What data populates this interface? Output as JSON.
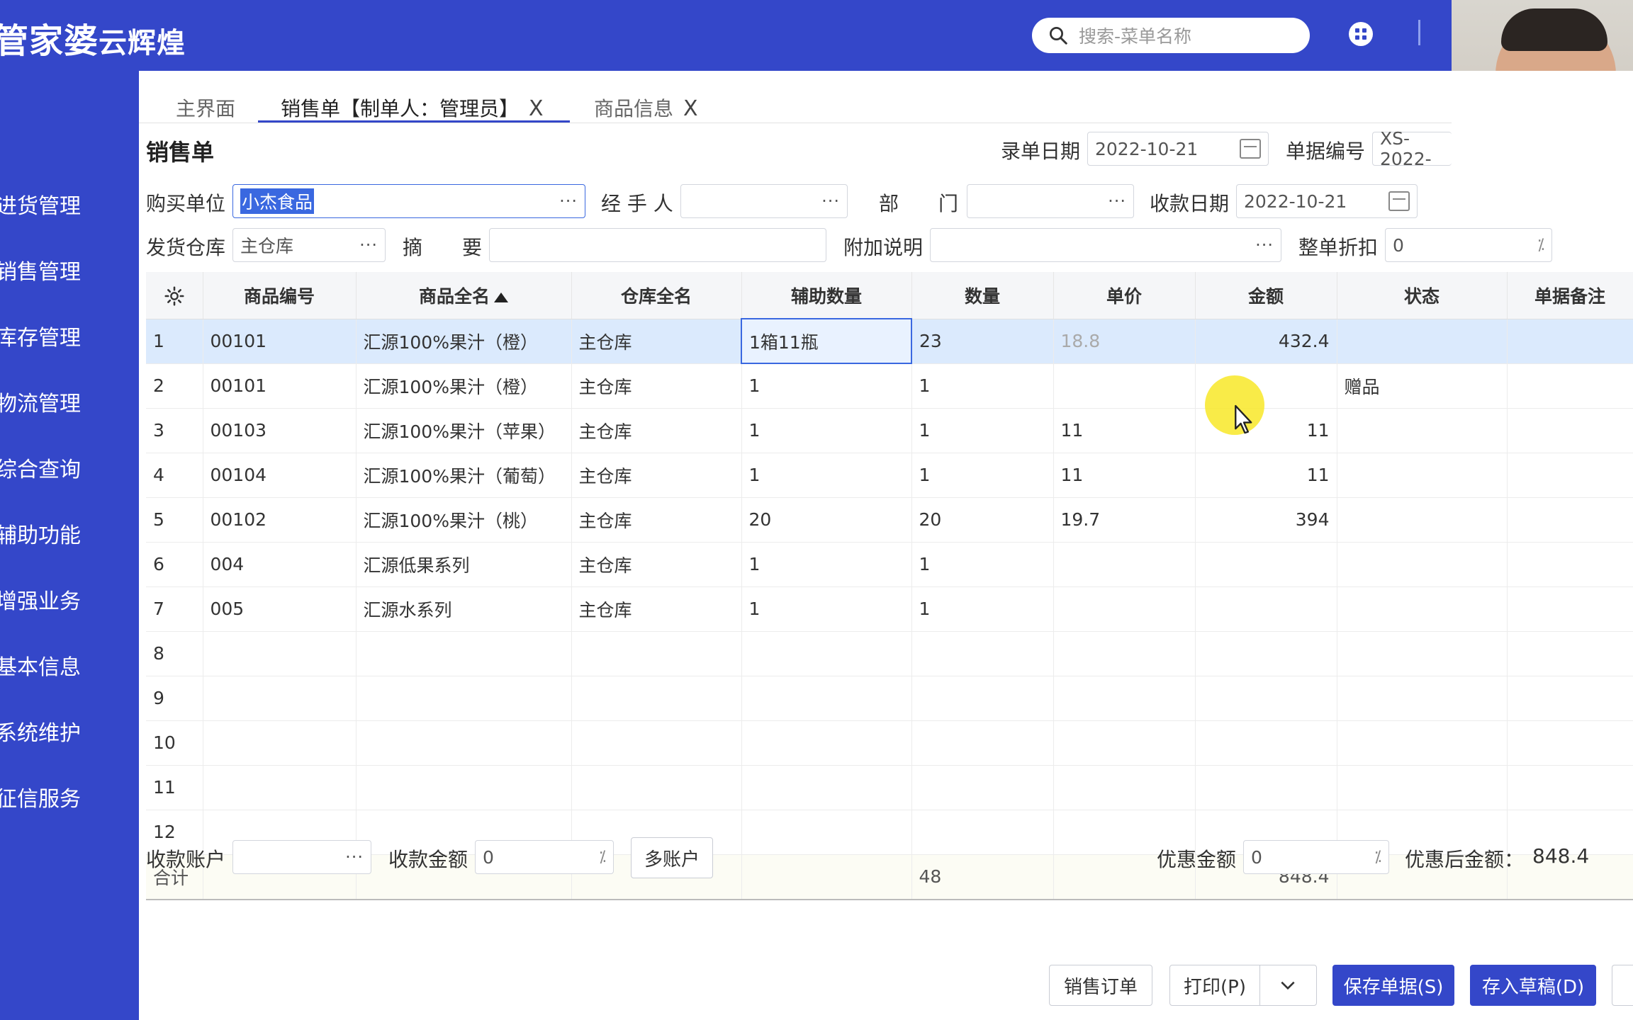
{
  "app": {
    "logo_text": "管家婆",
    "logo_sub": "云辉煌",
    "search_placeholder": "搜索-菜单名称"
  },
  "sidebar": {
    "items": [
      {
        "label": "进货管理"
      },
      {
        "label": "销售管理"
      },
      {
        "label": "库存管理"
      },
      {
        "label": "物流管理"
      },
      {
        "label": "综合查询"
      },
      {
        "label": "辅助功能"
      },
      {
        "label": "增强业务"
      },
      {
        "label": "基本信息"
      },
      {
        "label": "系统维护"
      },
      {
        "label": "征信服务"
      }
    ]
  },
  "tabs": [
    {
      "label": "主界面"
    },
    {
      "label": "销售单【制单人：管理员】",
      "close": "X"
    },
    {
      "label": "商品信息",
      "close": "X"
    }
  ],
  "form": {
    "title": "销售单",
    "entry_date_label": "录单日期",
    "entry_date": "2022-10-21",
    "doc_no_label": "单据编号",
    "doc_no": "XS-2022-",
    "buyer_label": "购买单位",
    "buyer": "小杰食品",
    "handler_label": "经 手 人",
    "handler": "",
    "dept_label_1": "部",
    "dept_label_2": "门",
    "dept": "",
    "pay_date_label": "收款日期",
    "pay_date": "2022-10-21",
    "warehouse_label": "发货仓库",
    "warehouse": "主仓库",
    "summary_label_1": "摘",
    "summary_label_2": "要",
    "summary": "",
    "note_label": "附加说明",
    "note": "",
    "discount_label": "整单折扣",
    "discount": "0",
    "dots": "···"
  },
  "table": {
    "headers": {
      "code": "商品编号",
      "name": "商品全名",
      "wh": "仓库全名",
      "aux_qty": "辅助数量",
      "qty": "数量",
      "price": "单价",
      "amount": "金额",
      "status": "状态",
      "remark": "单据备注"
    },
    "rows": [
      {
        "idx": "1",
        "code": "00101",
        "name": "汇源100%果汁（橙）",
        "wh": "主仓库",
        "aux_qty": "1箱11瓶",
        "qty": "23",
        "price": "18.8",
        "amount": "432.4",
        "status": "",
        "remark": ""
      },
      {
        "idx": "2",
        "code": "00101",
        "name": "汇源100%果汁（橙）",
        "wh": "主仓库",
        "aux_qty": "1",
        "qty": "1",
        "price": "",
        "amount": "",
        "status": "赠品",
        "remark": ""
      },
      {
        "idx": "3",
        "code": "00103",
        "name": "汇源100%果汁（苹果）",
        "wh": "主仓库",
        "aux_qty": "1",
        "qty": "1",
        "price": "11",
        "amount": "11",
        "status": "",
        "remark": ""
      },
      {
        "idx": "4",
        "code": "00104",
        "name": "汇源100%果汁（葡萄）",
        "wh": "主仓库",
        "aux_qty": "1",
        "qty": "1",
        "price": "11",
        "amount": "11",
        "status": "",
        "remark": ""
      },
      {
        "idx": "5",
        "code": "00102",
        "name": "汇源100%果汁（桃）",
        "wh": "主仓库",
        "aux_qty": "20",
        "qty": "20",
        "price": "19.7",
        "amount": "394",
        "status": "",
        "remark": ""
      },
      {
        "idx": "6",
        "code": "004",
        "name": "汇源低果系列",
        "wh": "主仓库",
        "aux_qty": "1",
        "qty": "1",
        "price": "",
        "amount": "",
        "status": "",
        "remark": ""
      },
      {
        "idx": "7",
        "code": "005",
        "name": "汇源水系列",
        "wh": "主仓库",
        "aux_qty": "1",
        "qty": "1",
        "price": "",
        "amount": "",
        "status": "",
        "remark": ""
      },
      {
        "idx": "8",
        "code": "",
        "name": "",
        "wh": "",
        "aux_qty": "",
        "qty": "",
        "price": "",
        "amount": "",
        "status": "",
        "remark": ""
      },
      {
        "idx": "9",
        "code": "",
        "name": "",
        "wh": "",
        "aux_qty": "",
        "qty": "",
        "price": "",
        "amount": "",
        "status": "",
        "remark": ""
      },
      {
        "idx": "10",
        "code": "",
        "name": "",
        "wh": "",
        "aux_qty": "",
        "qty": "",
        "price": "",
        "amount": "",
        "status": "",
        "remark": ""
      },
      {
        "idx": "11",
        "code": "",
        "name": "",
        "wh": "",
        "aux_qty": "",
        "qty": "",
        "price": "",
        "amount": "",
        "status": "",
        "remark": ""
      },
      {
        "idx": "12",
        "code": "",
        "name": "",
        "wh": "",
        "aux_qty": "",
        "qty": "",
        "price": "",
        "amount": "",
        "status": "",
        "remark": ""
      }
    ],
    "total": {
      "label": "合计",
      "qty": "48",
      "amount": "848.4"
    }
  },
  "footer": {
    "account_label": "收款账户",
    "account": "",
    "pay_amount_label": "收款金额",
    "pay_amount": "0",
    "multi_account": "多账户",
    "discount_amount_label": "优惠金额",
    "discount_amount": "0",
    "after_discount_label": "优惠后金额：",
    "after_discount": "848.4",
    "btn_sales_order": "销售订单",
    "btn_print": "打印(P)",
    "btn_save": "保存单据(S)",
    "btn_draft": "存入草稿(D)"
  },
  "colors": {
    "brand": "#3447c9",
    "selection": "#3a68e0",
    "active_row": "#dbeafd",
    "cursor_highlight": "#f8e828"
  }
}
